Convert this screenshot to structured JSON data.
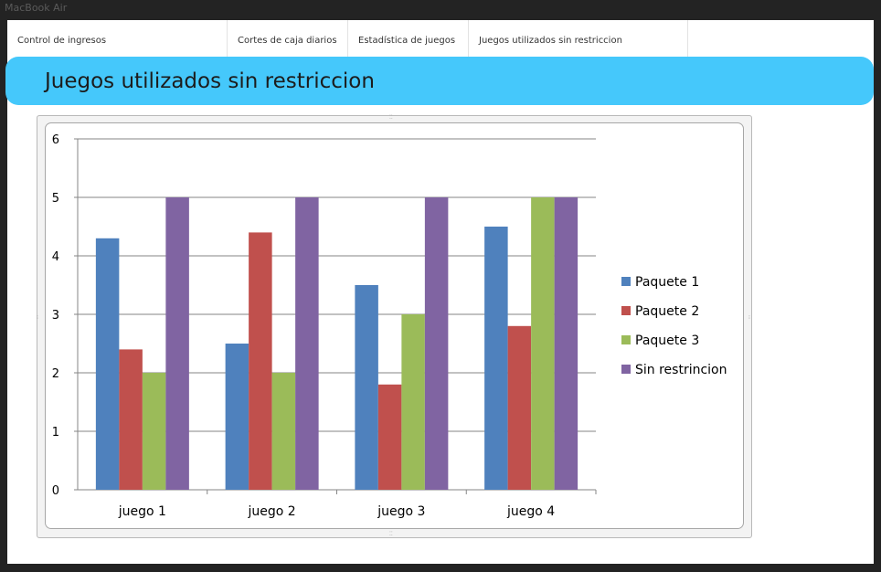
{
  "window": {
    "title": "MacBook Air"
  },
  "tabs": [
    {
      "label": "Control de ingresos"
    },
    {
      "label": "Cortes de caja diarios"
    },
    {
      "label": "Estadística de juegos"
    },
    {
      "label": "Juegos utilizados sin restriccion"
    }
  ],
  "page": {
    "title": "Juegos utilizados sin restriccion"
  },
  "colors": {
    "banner": "#45c8fb",
    "series": [
      "#4f81bd",
      "#c0504d",
      "#9bbb59",
      "#8064a2"
    ]
  },
  "chart_data": {
    "type": "bar",
    "categories": [
      "juego 1",
      "juego 2",
      "juego 3",
      "juego 4"
    ],
    "series": [
      {
        "name": "Paquete 1",
        "values": [
          4.3,
          2.5,
          3.5,
          4.5
        ]
      },
      {
        "name": "Paquete 2",
        "values": [
          2.4,
          4.4,
          1.8,
          2.8
        ]
      },
      {
        "name": "Paquete 3",
        "values": [
          2.0,
          2.0,
          3.0,
          5.0
        ]
      },
      {
        "name": "Sin restrincion",
        "values": [
          5.0,
          5.0,
          5.0,
          5.0
        ]
      }
    ],
    "ylim": [
      0,
      6
    ],
    "yticks": [
      "0",
      "1",
      "2",
      "3",
      "4",
      "5",
      "6"
    ],
    "grid": true,
    "legend": "right"
  }
}
